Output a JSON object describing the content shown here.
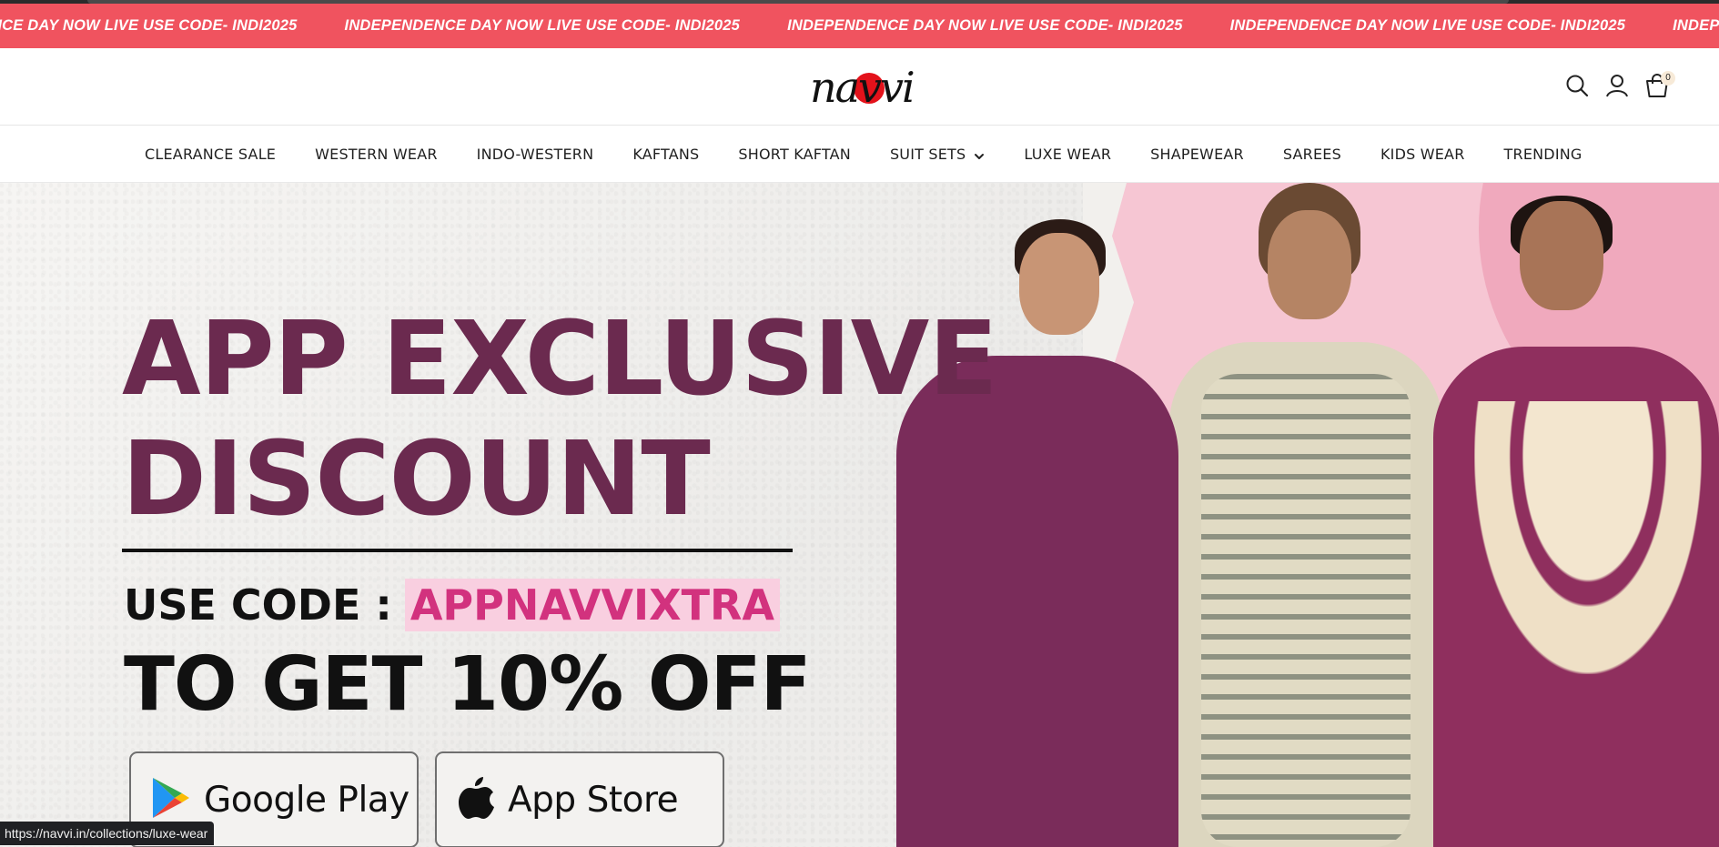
{
  "announcement": {
    "messages": [
      "INDEPENDENCE DAY NOW LIVE USE CODE- INDI2025",
      "INDEPENDENCE DAY NOW LIVE USE CODE- INDI2025",
      "INDEPENDENCE DAY NOW LIVE USE CODE- INDI2025",
      "INDEPENDENCE DAY NOW LIVE USE CODE- INDI2025",
      "INDEPENDENCE DAY NOW LIVE USE CODE- INDI2025"
    ],
    "background_color": "#f0535f"
  },
  "header": {
    "logo_text": "navvi",
    "logo_dot_color": "#e3121b",
    "icons": [
      "search-icon",
      "account-icon",
      "cart-icon"
    ],
    "cart_count": "0"
  },
  "nav": {
    "items": [
      {
        "label": "CLEARANCE SALE"
      },
      {
        "label": "WESTERN WEAR"
      },
      {
        "label": "INDO-WESTERN"
      },
      {
        "label": "KAFTANS"
      },
      {
        "label": "SHORT KAFTAN"
      },
      {
        "label": "SUIT SETS",
        "has_dropdown": true
      },
      {
        "label": "LUXE WEAR"
      },
      {
        "label": "SHAPEWEAR"
      },
      {
        "label": "SAREES"
      },
      {
        "label": "KIDS WEAR"
      },
      {
        "label": "TRENDING"
      }
    ]
  },
  "hero": {
    "headline_line1": "APP EXCLUSIVE",
    "headline_line2": "DISCOUNT",
    "headline_color": "#6b2a4f",
    "use_code_label": "USE CODE :",
    "code": "APPNAVVIXTRA",
    "code_color": "#d2327e",
    "code_highlight": "#f9cfe0",
    "offer": "TO GET 10% OFF",
    "stores": [
      {
        "label": "Google Play",
        "icon": "google-play-icon"
      },
      {
        "label": "App Store",
        "icon": "apple-icon"
      }
    ]
  },
  "status_bar": {
    "url": "https://navvi.in/collections/luxe-wear"
  }
}
